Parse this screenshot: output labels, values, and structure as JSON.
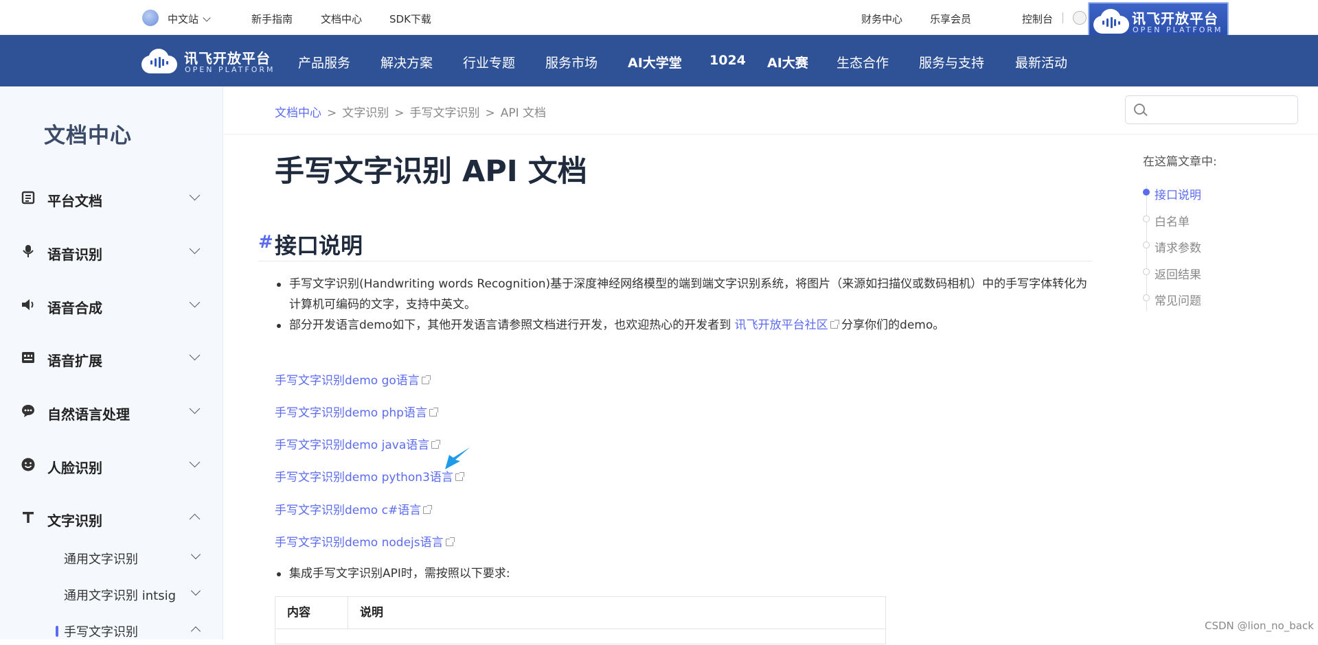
{
  "topbar": {
    "lang": "中文站",
    "links": [
      "新手指南",
      "文档中心",
      "SDK下载"
    ],
    "right_links": [
      "财务中心",
      "乐享会员",
      "控制台"
    ],
    "separator": "|"
  },
  "logo": {
    "cn": "讯飞开放平台",
    "en": "OPEN PLATFORM"
  },
  "nav": [
    "产品服务",
    "解决方案",
    "行业专题",
    "服务市场",
    "AI大学堂",
    "1024",
    "AI大赛",
    "生态合作",
    "服务与支持",
    "最新活动"
  ],
  "sidebar": {
    "title": "文档中心",
    "items": [
      {
        "label": "平台文档",
        "icon": "document-icon"
      },
      {
        "label": "语音识别",
        "icon": "microphone-icon"
      },
      {
        "label": "语音合成",
        "icon": "speaker-icon"
      },
      {
        "label": "语音扩展",
        "icon": "keyboard-icon"
      },
      {
        "label": "自然语言处理",
        "icon": "chat-bubble-icon"
      },
      {
        "label": "人脸识别",
        "icon": "face-icon"
      },
      {
        "label": "文字识别",
        "icon": "text-t-icon"
      }
    ],
    "subitems": [
      "通用文字识别",
      "通用文字识别 intsig",
      "手写文字识别"
    ]
  },
  "breadcrumb": {
    "items": [
      "文档中心",
      "文字识别",
      "手写文字识别",
      "API 文档"
    ],
    "sep": ">"
  },
  "search": {
    "placeholder": ""
  },
  "article": {
    "title": "手写文字识别 API 文档",
    "section_title": "接口说明",
    "hash": "#",
    "bullet1": "手写文字识别(Handwriting words Recognition)基于深度神经网络模型的端到端文字识别系统，将图片（来源如扫描仪或数码相机）中的手写字体转化为计算机可编码的文字，支持中英文。",
    "bullet2_pre": "部分开发语言demo如下，其他开发语言请参照文档进行开发，也欢迎热心的开发者到",
    "bullet2_link": "讯飞开放平台社区",
    "bullet2_post": "分享你们的demo。",
    "demos": [
      "手写文字识别demo go语言",
      "手写文字识别demo php语言",
      "手写文字识别demo java语言",
      "手写文字识别demo python3语言",
      "手写文字识别demo c#语言",
      "手写文字识别demo nodejs语言"
    ],
    "bullet3": "集成手写文字识别API时，需按照以下要求:",
    "table_headers": [
      "内容",
      "说明"
    ]
  },
  "toc": {
    "title": "在这篇文章中:",
    "items": [
      "接口说明",
      "白名单",
      "请求参数",
      "返回结果",
      "常见问题"
    ],
    "active_index": 0
  },
  "watermark": "CSDN @lion_no_back",
  "colors": {
    "nav_bg": "#2f5297",
    "accent": "#5b6bf0",
    "sidebar_bg": "#f5f8fc"
  }
}
